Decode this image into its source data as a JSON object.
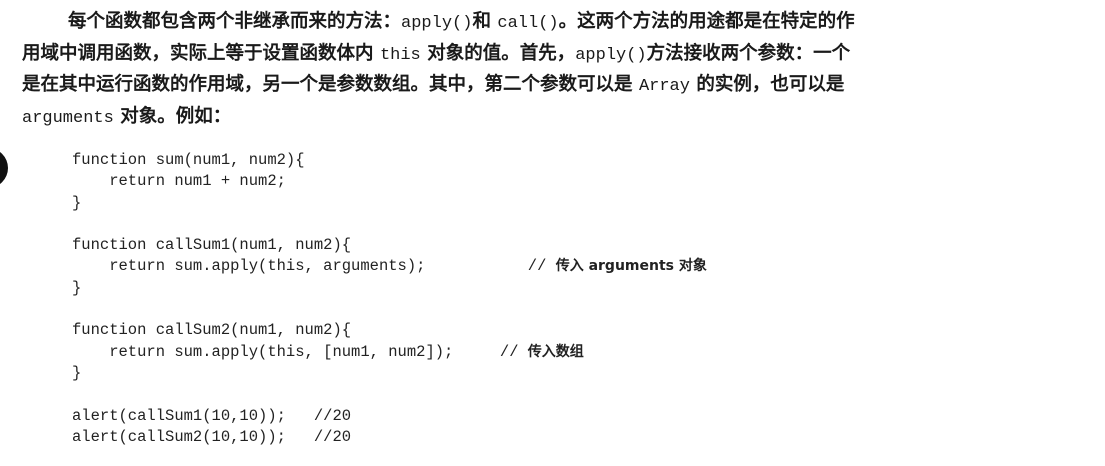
{
  "paragraph": {
    "lines": [
      [
        {
          "t": "text",
          "v": "每个函数都包含两个非继承而来的方法："
        },
        {
          "t": "code",
          "v": "apply()"
        },
        {
          "t": "text",
          "v": "和 "
        },
        {
          "t": "code",
          "v": "call()"
        },
        {
          "t": "text",
          "v": "。这两个方法的用途都是在特定的作"
        }
      ],
      [
        {
          "t": "text",
          "v": "用域中调用函数，实际上等于设置函数体内 "
        },
        {
          "t": "code",
          "v": "this"
        },
        {
          "t": "text",
          "v": " 对象的值。首先，"
        },
        {
          "t": "code",
          "v": "apply()"
        },
        {
          "t": "text",
          "v": "方法接收两个参数：一个"
        }
      ],
      [
        {
          "t": "text",
          "v": "是在其中运行函数的作用域，另一个是参数数组。其中，第二个参数可以是 "
        },
        {
          "t": "code",
          "v": "Array"
        },
        {
          "t": "text",
          "v": " 的实例，也可以是"
        }
      ],
      [
        {
          "t": "code",
          "v": "arguments"
        },
        {
          "t": "text",
          "v": " 对象。例如："
        }
      ]
    ]
  },
  "code": {
    "lines": [
      {
        "code": "function sum(num1, num2){",
        "comment": ""
      },
      {
        "code": "    return num1 + num2;",
        "comment": ""
      },
      {
        "code": "}",
        "comment": ""
      },
      {
        "code": "",
        "comment": ""
      },
      {
        "code": "function callSum1(num1, num2){",
        "comment": ""
      },
      {
        "code": "    return sum.apply(this, arguments);",
        "pad": "           ",
        "comment_prefix": "// ",
        "comment": "传入 arguments 对象"
      },
      {
        "code": "}",
        "comment": ""
      },
      {
        "code": "",
        "comment": ""
      },
      {
        "code": "function callSum2(num1, num2){",
        "comment": ""
      },
      {
        "code": "    return sum.apply(this, [num1, num2]);",
        "pad": "     ",
        "comment_prefix": "// ",
        "comment": "传入数组"
      },
      {
        "code": "}",
        "comment": ""
      },
      {
        "code": "",
        "comment": ""
      },
      {
        "code": "alert(callSum1(10,10));",
        "pad": "   ",
        "comment_prefix": "",
        "comment": "//20",
        "comment_mono": true
      },
      {
        "code": "alert(callSum2(10,10));",
        "pad": "   ",
        "comment_prefix": "",
        "comment": "//20",
        "comment_mono": true
      }
    ]
  }
}
